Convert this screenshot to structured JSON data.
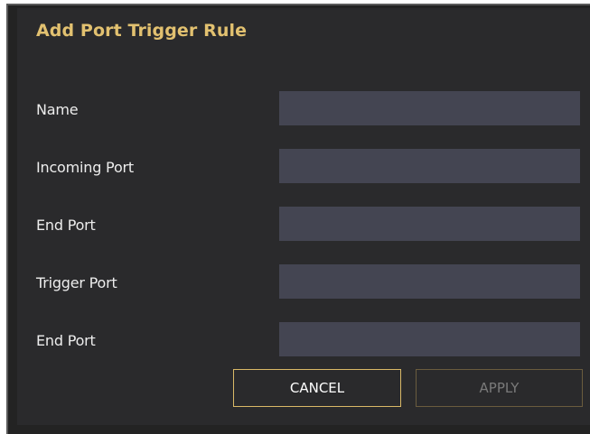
{
  "dialog": {
    "title": "Add Port Trigger Rule"
  },
  "form": {
    "fields": [
      {
        "label": "Name",
        "value": ""
      },
      {
        "label": "Incoming Port",
        "value": ""
      },
      {
        "label": "End Port",
        "value": ""
      },
      {
        "label": "Trigger Port",
        "value": ""
      },
      {
        "label": "End Port",
        "value": ""
      }
    ]
  },
  "buttons": {
    "cancel_label": "CANCEL",
    "apply_label": "APPLY"
  },
  "colors": {
    "title_accent": "#e2c170",
    "panel_background": "#2a2a2c",
    "input_background": "#444552",
    "cancel_border": "#d9b867",
    "apply_text_disabled": "#7a7a7a"
  }
}
